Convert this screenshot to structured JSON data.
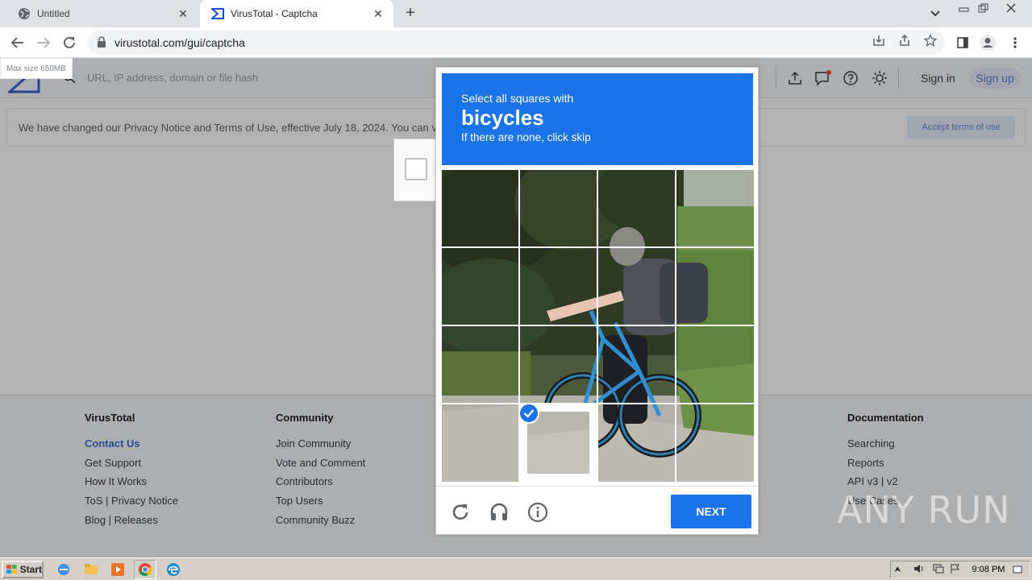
{
  "browser": {
    "tabs": [
      {
        "title": "Untitled",
        "active": false
      },
      {
        "title": "VirusTotal - Captcha",
        "active": true
      }
    ],
    "url": "virustotal.com/gui/captcha"
  },
  "virustotal": {
    "search_placeholder": "URL, IP address, domain or file hash",
    "max_size": "Max size 650MB",
    "sign_in": "Sign in",
    "sign_up": "Sign up",
    "notice": "We have changed our Privacy Notice and Terms of Use, effective July 18, 2024. You can v",
    "accept_terms": "Accept terms of use",
    "footer": {
      "virustotal": {
        "heading": "VirusTotal",
        "links": [
          "Contact Us",
          "Get Support",
          "How It Works",
          "ToS | Privacy Notice",
          "Blog | Releases"
        ]
      },
      "community": {
        "heading": "Community",
        "links": [
          "Join Community",
          "Vote and Comment",
          "Contributors",
          "Top Users",
          "Community Buzz"
        ]
      },
      "documentation": {
        "heading": "Documentation",
        "links": [
          "Searching",
          "Reports",
          "API v3 | v2",
          "Use Cases"
        ]
      }
    }
  },
  "captcha": {
    "instruction": "Select all squares with",
    "target": "bicycles",
    "hint": "If there are none, click skip",
    "selected_tile": 13,
    "next_label": "NEXT",
    "accent": "#1a73e8"
  },
  "watermark": "ANY RUN",
  "taskbar": {
    "start_label": "Start",
    "clock": "9:08 PM"
  }
}
